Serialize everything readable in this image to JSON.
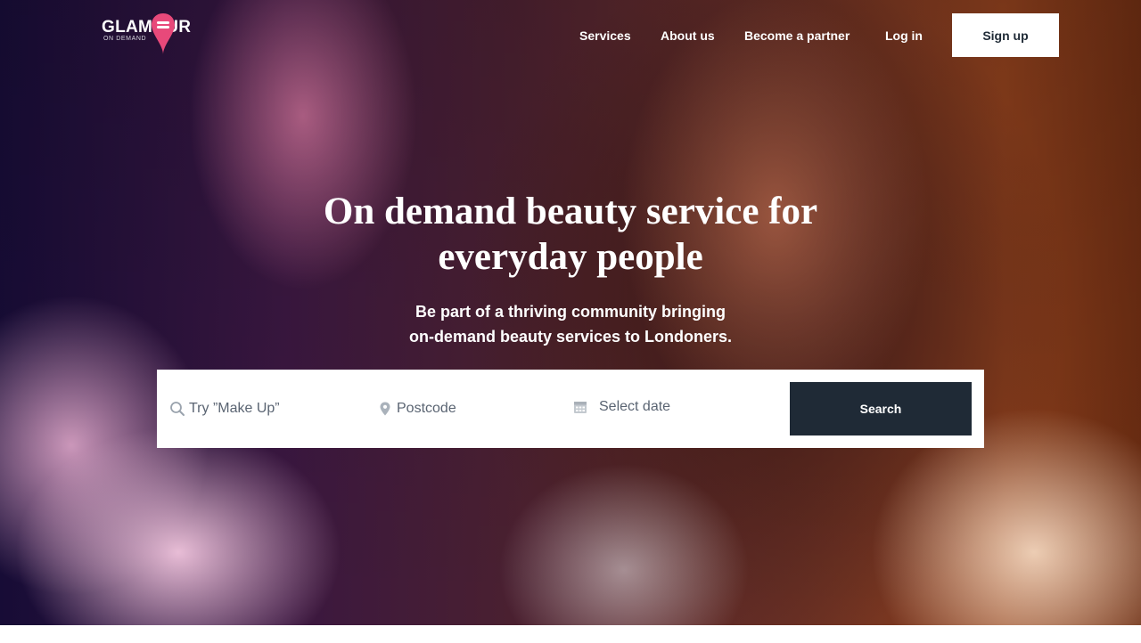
{
  "brand": {
    "name": "GLAMOUR",
    "tagline": "ON DEMAND",
    "accent_color": "#e8497a"
  },
  "nav": {
    "items": [
      {
        "label": "Services"
      },
      {
        "label": "About us"
      },
      {
        "label": "Become a partner"
      },
      {
        "label": "Log in"
      }
    ],
    "signup_label": "Sign up"
  },
  "hero": {
    "headline_line1": "On demand beauty service for",
    "headline_line2": "everyday people",
    "subline_line1": "Be part of a thriving community bringing",
    "subline_line2": "on-demand beauty services to Londoners."
  },
  "search": {
    "service_placeholder": "Try ”Make Up”",
    "postcode_placeholder": "Postcode",
    "date_placeholder": "Select date",
    "button_label": "Search",
    "icons": [
      "search-icon",
      "location-pin-icon",
      "calendar-icon"
    ],
    "button_color": "#1f2a36"
  }
}
